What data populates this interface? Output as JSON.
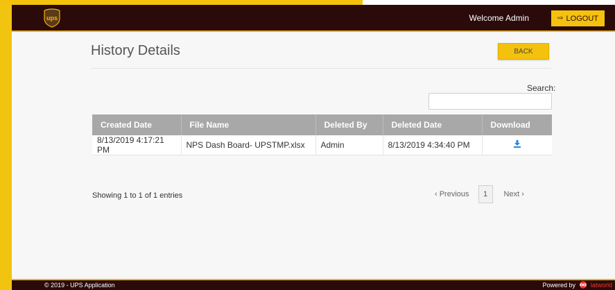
{
  "header": {
    "logo_text": "ups",
    "welcome": "Welcome Admin",
    "logout_label": "LOGOUT",
    "logout_icon": "logout-icon"
  },
  "page": {
    "title": "History Details",
    "back_label": "BACK",
    "search_label": "Search:",
    "search_value": ""
  },
  "table": {
    "columns": [
      "Created Date",
      "File Name",
      "Deleted By",
      "Deleted Date",
      "Download"
    ],
    "rows": [
      {
        "created_date": "8/13/2019 4:17:21 PM",
        "file_name": "NPS Dash Board- UPSTMP.xlsx",
        "deleted_by": "Admin",
        "deleted_date": "8/13/2019 4:34:40 PM",
        "download_icon": "download-icon"
      }
    ]
  },
  "pagination": {
    "info": "Showing 1 to 1 of 1 entries",
    "previous": "‹ Previous",
    "current_page": "1",
    "next": "Next ›"
  },
  "footer": {
    "copyright": "© 2019 - UPS Application",
    "powered_by": "Powered by",
    "brand": "Infinity logo"
  },
  "colors": {
    "nav_bg": "#2b0a0a",
    "accent": "#f4c20d",
    "header_row": "#a8a8a8",
    "download_icon": "#1e88e5"
  }
}
